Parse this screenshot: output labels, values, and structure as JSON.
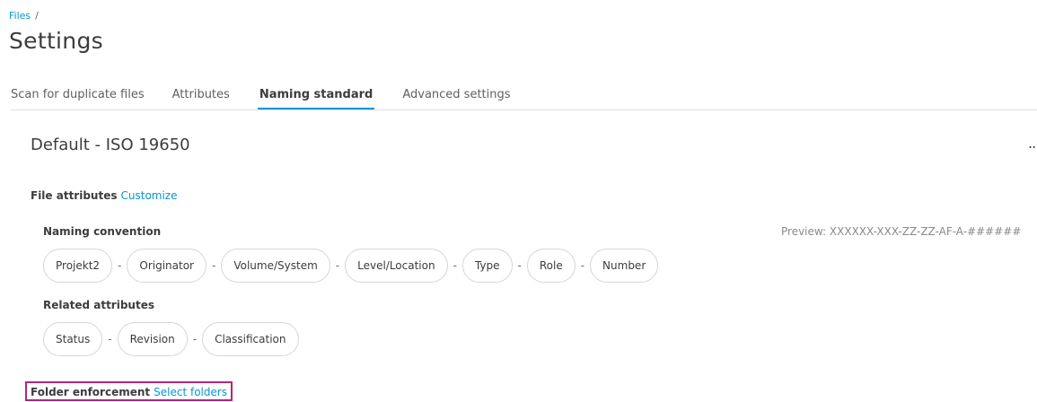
{
  "breadcrumb": {
    "root": "Files",
    "separator": "/"
  },
  "page": {
    "title": "Settings"
  },
  "tabs": [
    {
      "label": "Scan for duplicate files"
    },
    {
      "label": "Attributes"
    },
    {
      "label": "Naming standard",
      "active": true
    },
    {
      "label": "Advanced settings"
    }
  ],
  "standard": {
    "title": "Default - ISO 19650",
    "more_label": ".."
  },
  "file_attributes": {
    "label": "File attributes",
    "link": "Customize"
  },
  "naming_convention": {
    "label": "Naming convention",
    "preview": "Preview: XXXXXX-XXX-ZZ-ZZ-AF-A-######",
    "separator": "-",
    "chips": [
      "Projekt2",
      "Originator",
      "Volume/System",
      "Level/Location",
      "Type",
      "Role",
      "Number"
    ]
  },
  "related_attributes": {
    "label": "Related attributes",
    "separator": "-",
    "chips": [
      "Status",
      "Revision",
      "Classification"
    ]
  },
  "folder_enforcement": {
    "label": "Folder enforcement",
    "link": "Select folders"
  },
  "colors": {
    "accent": "#0696d7",
    "highlight": "#b0267a",
    "text": "#3c3c3c",
    "border": "#d6d6d6"
  }
}
